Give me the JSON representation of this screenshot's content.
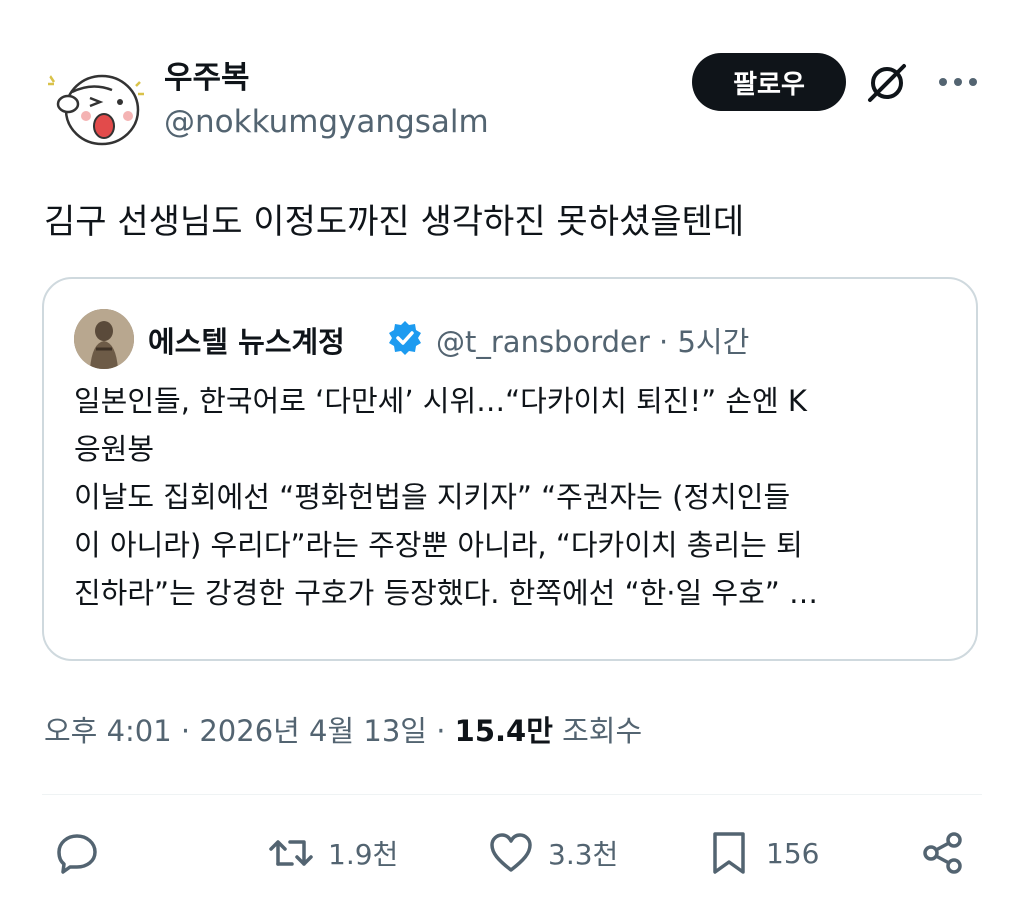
{
  "author": {
    "display_name": "우주복",
    "handle": "@nokkumgyangsalm"
  },
  "header": {
    "follow_label": "팔로우",
    "grok_icon": "grok-slash-icon",
    "more_icon": "more-horizontal-icon"
  },
  "tweet": {
    "text": "김구 선생님도 이정도까진 생각하진 못하셨을텐데"
  },
  "quote": {
    "display_name": "에스텔 뉴스계정",
    "verified_color": "#1d9bf0",
    "handle_time": "@t_ransborder · 5시간",
    "lines": [
      "일본인들, 한국어로 ‘다만세’ 시위…“다카이치 퇴진!” 손엔 K",
      "응원봉",
      "이날도 집회에선 “평화헌법을 지키자” “주권자는 (정치인들",
      "이 아니라) 우리다”라는 주장뿐 아니라, “다카이치 총리는 퇴",
      "진하라”는 강경한 구호가 등장했다. 한쪽에선 “한·일 우호” …"
    ]
  },
  "meta": {
    "time_date": "오후 4:01 · 2026년 4월 13일 · ",
    "views_count": "15.4만",
    "views_label": "조회수"
  },
  "actions": {
    "reply_icon": "reply-icon",
    "retweet_count": "1.9천",
    "like_count": "3.3천",
    "bookmark_count": "156",
    "share_icon": "share-icon"
  }
}
